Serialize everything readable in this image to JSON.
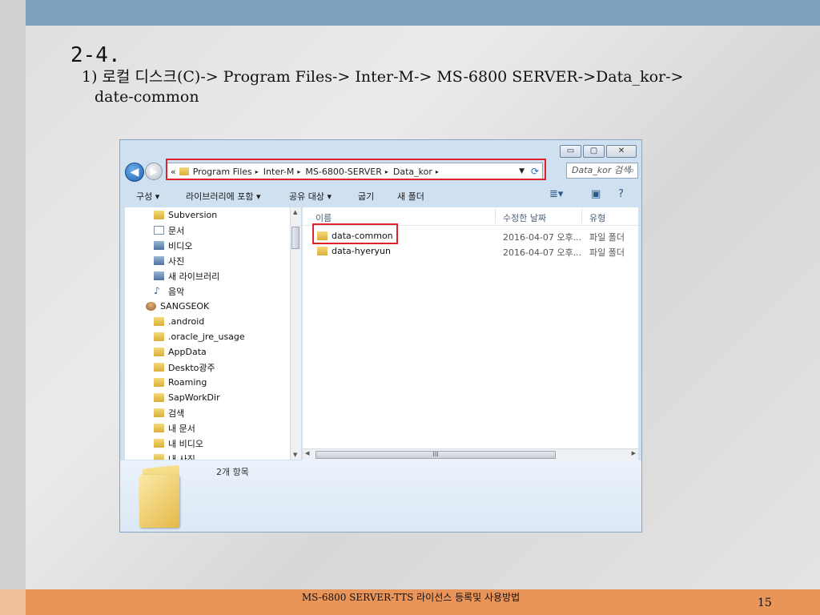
{
  "slide": {
    "title": "2-4.",
    "path_line1": "1) 로컬 디스크(C)-> Program Files-> Inter-M-> MS-6800 SERVER->Data_kor->",
    "path_line2": "date-common",
    "footer": "MS-6800 SERVER-TTS 라이선스 등록및 사용방법",
    "page_number": "15",
    "colors": {
      "top_bar": "#7ea2bd",
      "bottom_bar": "#e9955a",
      "highlight": "#e0232a"
    }
  },
  "explorer": {
    "window_buttons": {
      "minimize": "▭",
      "maximize": "▢",
      "close": "✕"
    },
    "nav": {
      "back": "◀",
      "forward": "▶"
    },
    "address": {
      "prefix": "«",
      "segments": [
        "Program Files",
        "Inter-M",
        "MS-6800-SERVER",
        "Data_kor"
      ],
      "separator": "▸",
      "dropdown": "▼",
      "refresh": "⟳"
    },
    "search": {
      "placeholder": "Data_kor 검색",
      "icon": "search-icon"
    },
    "toolbar": {
      "organize": "구성 ▾",
      "include_library": "라이브러리에 포함 ▾",
      "share": "공유 대상 ▾",
      "burn": "굽기",
      "new_folder": "새 폴더",
      "view_icon": "≣▾",
      "pane_icon": "▣",
      "help_icon": "?"
    },
    "nav_tree": [
      {
        "label": "Subversion",
        "icon": "folder-icon",
        "indent": 1
      },
      {
        "label": "문서",
        "icon": "document-icon",
        "indent": 1
      },
      {
        "label": "비디오",
        "icon": "video-icon",
        "indent": 1
      },
      {
        "label": "사진",
        "icon": "picture-icon",
        "indent": 1
      },
      {
        "label": "새 라이브러리",
        "icon": "library-icon",
        "indent": 1
      },
      {
        "label": "음악",
        "icon": "music-icon",
        "indent": 1
      },
      {
        "label": "SANGSEOK",
        "icon": "user-icon",
        "indent": 0
      },
      {
        "label": ".android",
        "icon": "folder-icon",
        "indent": 1
      },
      {
        "label": ".oracle_jre_usage",
        "icon": "folder-icon",
        "indent": 1
      },
      {
        "label": "AppData",
        "icon": "folder-icon",
        "indent": 1
      },
      {
        "label": "Deskto광주",
        "icon": "folder-icon",
        "indent": 1
      },
      {
        "label": "Roaming",
        "icon": "folder-icon",
        "indent": 1
      },
      {
        "label": "SapWorkDir",
        "icon": "folder-icon",
        "indent": 1
      },
      {
        "label": "검색",
        "icon": "folder-icon",
        "indent": 1
      },
      {
        "label": "내 문서",
        "icon": "folder-icon",
        "indent": 1
      },
      {
        "label": "내 비디오",
        "icon": "folder-icon",
        "indent": 1
      },
      {
        "label": "내 사진",
        "icon": "folder-icon",
        "indent": 1
      }
    ],
    "columns": {
      "name": "이름",
      "modified": "수정한 날짜",
      "type": "유형"
    },
    "files": [
      {
        "name": "data-common",
        "modified": "2016-04-07 오후...",
        "type": "파일 폴더"
      },
      {
        "name": "data-hyeryun",
        "modified": "2016-04-07 오후...",
        "type": "파일 폴더"
      }
    ],
    "hscroll_grip": "III",
    "status": "2개 항목"
  }
}
